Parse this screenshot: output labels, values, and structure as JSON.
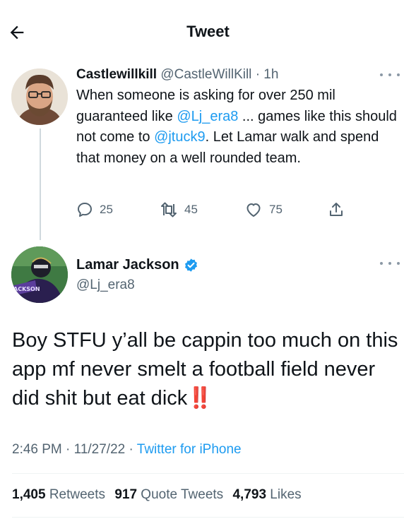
{
  "header": {
    "title": "Tweet"
  },
  "reply": {
    "name": "Castlewillkill",
    "handle": "@CastleWillKill",
    "dot": "·",
    "time": "1h",
    "text_1": "When someone is asking for over 250 mil guaranteed like ",
    "mention_1": "@Lj_era8",
    "text_2": " ... games like this should not come to ",
    "mention_2": "@jtuck9",
    "text_3": ". Let Lamar walk and spend that money on a well rounded team.",
    "reply_count": "25",
    "retweet_count": "45",
    "like_count": "75"
  },
  "tweet": {
    "name": "Lamar Jackson",
    "handle": "@Lj_era8",
    "text": "Boy STFU y’all be cappin too much on this app mf never smelt a football field never did shit but eat dick",
    "emoji": "‼️",
    "time": "2:46 PM",
    "sep_1": " · ",
    "date": "11/27/22",
    "sep_2": " · ",
    "source": "Twitter for iPhone",
    "retweets": "1,405",
    "retweets_label": "Retweets",
    "quotes": "917",
    "quotes_label": "Quote Tweets",
    "likes": "4,793",
    "likes_label": "Likes"
  },
  "icons": {
    "back": "arrow-left-icon",
    "reply": "speech-bubble-icon",
    "retweet": "retweet-icon",
    "like": "heart-icon",
    "share": "share-icon",
    "verified": "verified-badge-icon",
    "more": "ellipsis-icon"
  },
  "colors": {
    "link": "#1d9bf0",
    "secondary_text": "#536471",
    "primary_text": "#0f1419",
    "emoji_red": "#e0152a"
  }
}
